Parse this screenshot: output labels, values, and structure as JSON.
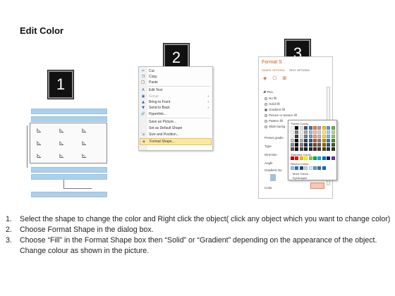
{
  "title": "Edit Color",
  "steps": {
    "one": "1",
    "two": "2",
    "three": "3"
  },
  "context_menu": {
    "items": [
      {
        "icon": "✂",
        "label": "Cut",
        "disabled": false
      },
      {
        "icon": "❐",
        "label": "Copy",
        "disabled": false
      },
      {
        "icon": "📋",
        "label": "Paste",
        "disabled": false
      },
      {
        "icon": "A",
        "label": "Edit Text",
        "disabled": false
      },
      {
        "icon": "▣",
        "label": "Group",
        "disabled": true,
        "submenu": true
      },
      {
        "icon": "▲",
        "label": "Bring to Front",
        "disabled": false,
        "submenu": true
      },
      {
        "icon": "▼",
        "label": "Send to Back",
        "disabled": false,
        "submenu": true
      },
      {
        "icon": "🔗",
        "label": "Hyperlink...",
        "disabled": false
      },
      {
        "icon": "",
        "label": "Save as Picture...",
        "disabled": false
      },
      {
        "icon": "",
        "label": "Set as Default Shape",
        "disabled": false
      },
      {
        "icon": "⇲",
        "label": "Size and Position...",
        "disabled": false
      },
      {
        "icon": "◈",
        "label": "Format Shape...",
        "disabled": false,
        "highlight": true
      }
    ]
  },
  "format_pane": {
    "title": "Format S",
    "tab_shape": "SHAPE OPTIONS",
    "tab_text": "TEXT OPTIONS",
    "section": "FILL",
    "options": {
      "no_fill": "No fill",
      "solid_fill": "Solid fill",
      "gradient_fill": "Gradient fill",
      "picture_fill": "Picture or texture fill",
      "pattern_fill": "Pattern fill",
      "slide_bg": "Slide backg"
    },
    "fields": {
      "preset": "Preset gradie",
      "type": "Type",
      "direction": "Direction",
      "angle": "Angle",
      "stops": "Gradient sto",
      "color": "Color"
    }
  },
  "palette": {
    "theme_label": "Theme Colors",
    "standard_label": "Standard Colors",
    "recent_label": "Recent Colors",
    "more_colors": "More Colors...",
    "eyedropper": "Eyedropper",
    "theme_colors": [
      "#ffffff",
      "#000000",
      "#e7e6e6",
      "#44546a",
      "#4472c4",
      "#ed7d31",
      "#a5a5a5",
      "#ffc000",
      "#5b9bd5",
      "#70ad47"
    ],
    "standard_colors": [
      "#c00000",
      "#ff0000",
      "#ffc000",
      "#ffff00",
      "#92d050",
      "#00b050",
      "#00b0f0",
      "#0070c0",
      "#002060",
      "#7030a0"
    ],
    "recent_colors": [
      "#9dc3e6",
      "#2e75b6",
      "#1f4e79",
      "#bdd7ee",
      "#deebf7",
      "#5b9bd5",
      "#41719c",
      "#0070c0"
    ]
  },
  "instructions": [
    {
      "num": "1.",
      "text": "Select the shape to change the color and Right click the object( click any object which you want to change color)"
    },
    {
      "num": "2.",
      "text": "Choose Format Shape in the dialog box."
    },
    {
      "num": "3.",
      "text": "Choose “Fill” in the Format Shape box then “Solid” or “Gradient” depending on the appearance of the object. Change colour as shown in the picture."
    }
  ]
}
